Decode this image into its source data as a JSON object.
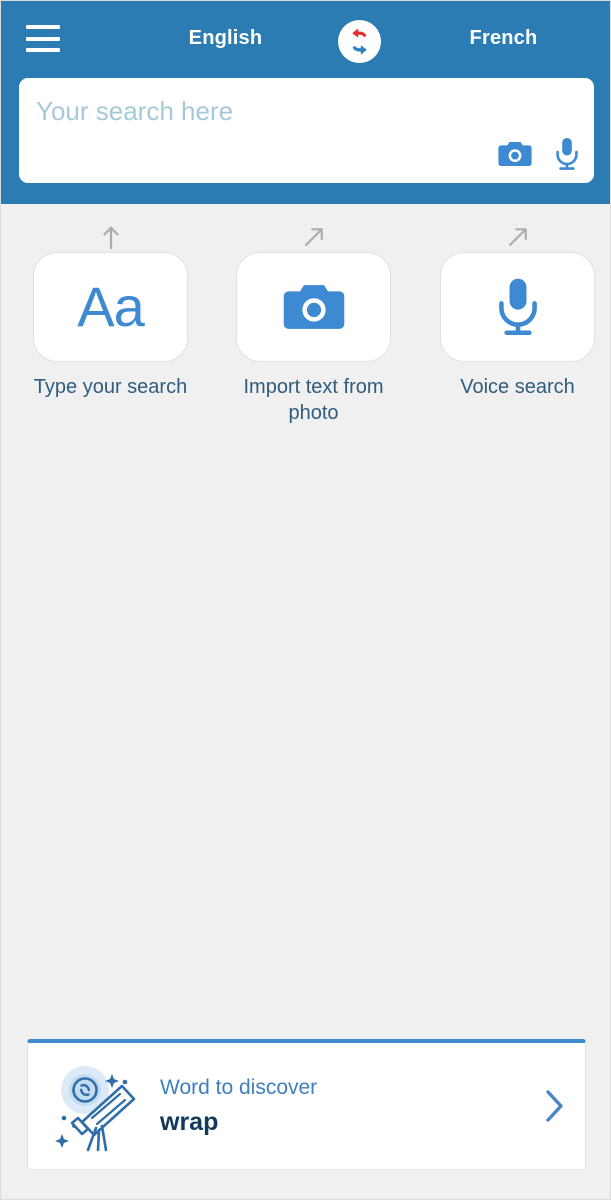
{
  "header": {
    "menu_icon": "hamburger-menu-icon",
    "source_language": "English",
    "target_language": "French",
    "swap_icon": "swap-languages-icon"
  },
  "search": {
    "placeholder": "Your search here",
    "value": "",
    "camera_icon": "camera-icon",
    "microphone_icon": "microphone-icon"
  },
  "shortcuts": [
    {
      "label": "Type your search",
      "icon": "aa-text-icon",
      "icon_text": "Aa",
      "hint_arrow": "arrow-up-icon"
    },
    {
      "label": "Import text from photo",
      "icon": "camera-icon",
      "hint_arrow": "arrow-up-right-icon"
    },
    {
      "label": "Voice search",
      "icon": "microphone-icon",
      "hint_arrow": "arrow-up-right-icon"
    }
  ],
  "discover": {
    "title": "Word to discover",
    "word": "wrap",
    "illustration_icon": "telescope-icon",
    "chevron_icon": "chevron-right-icon"
  },
  "colors": {
    "header_blue": "#2c7cb4",
    "accent_blue": "#3d8ad2",
    "body_background": "#f0f0f0",
    "label_text": "#2f5c7e",
    "word_text": "#12395c",
    "placeholder": "#a6c9da",
    "swap_arrow_red": "#e03131",
    "swap_arrow_blue": "#2f7fc1"
  }
}
